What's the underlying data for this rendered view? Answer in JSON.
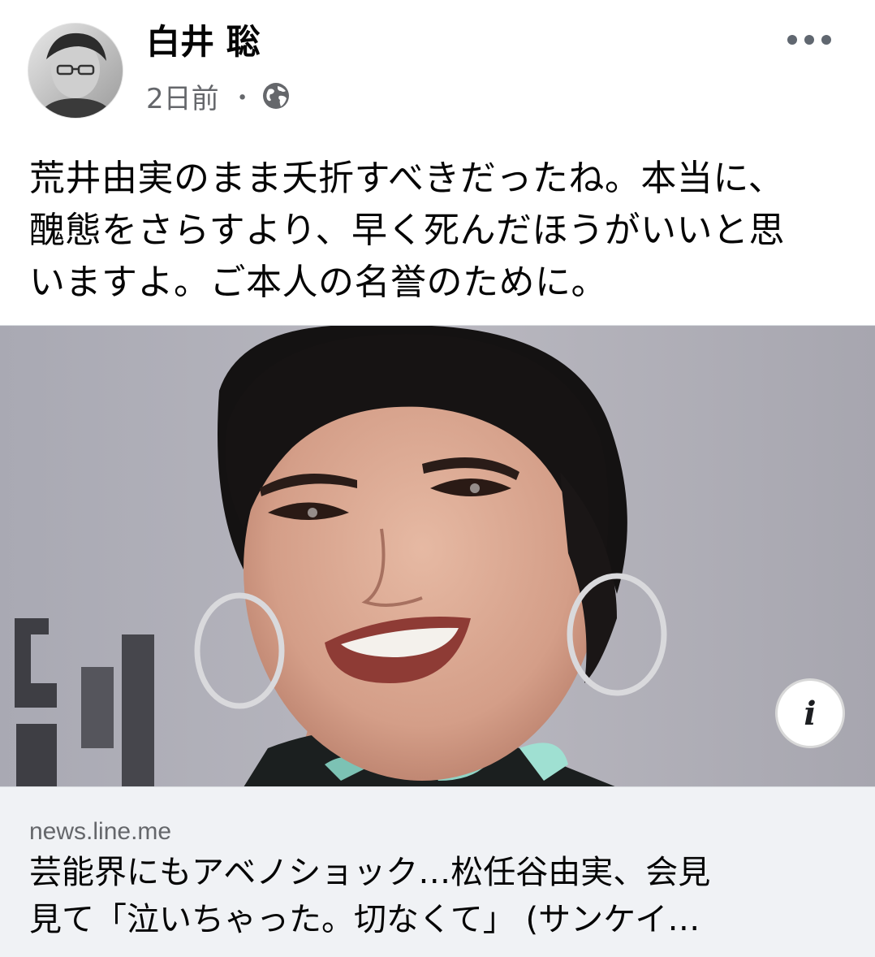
{
  "post": {
    "author": {
      "name": "白井 聡",
      "avatar_icon": "profile-photo"
    },
    "meta": {
      "time": "2日前",
      "separator": "・",
      "audience_icon": "globe-icon"
    },
    "more_icon": "more-horizontal-icon",
    "text_lines": [
      "荒井由実のまま夭折すべきだったね。本当に、",
      "醜態をさらすより、早く死んだほうがいいと思",
      "いますよ。ご本人の名誉のために。"
    ],
    "link": {
      "info_label": "i",
      "domain": "news.line.me",
      "title_lines": [
        "芸能界にもアベノショック…松任谷由実、会見",
        "見て「泣いちゃった。切なくて」 (サンケイ…"
      ]
    }
  },
  "colors": {
    "text": "#050505",
    "secondary_text": "#65676b",
    "card_footer_bg": "#f0f2f5",
    "divider": "#dadde1"
  }
}
